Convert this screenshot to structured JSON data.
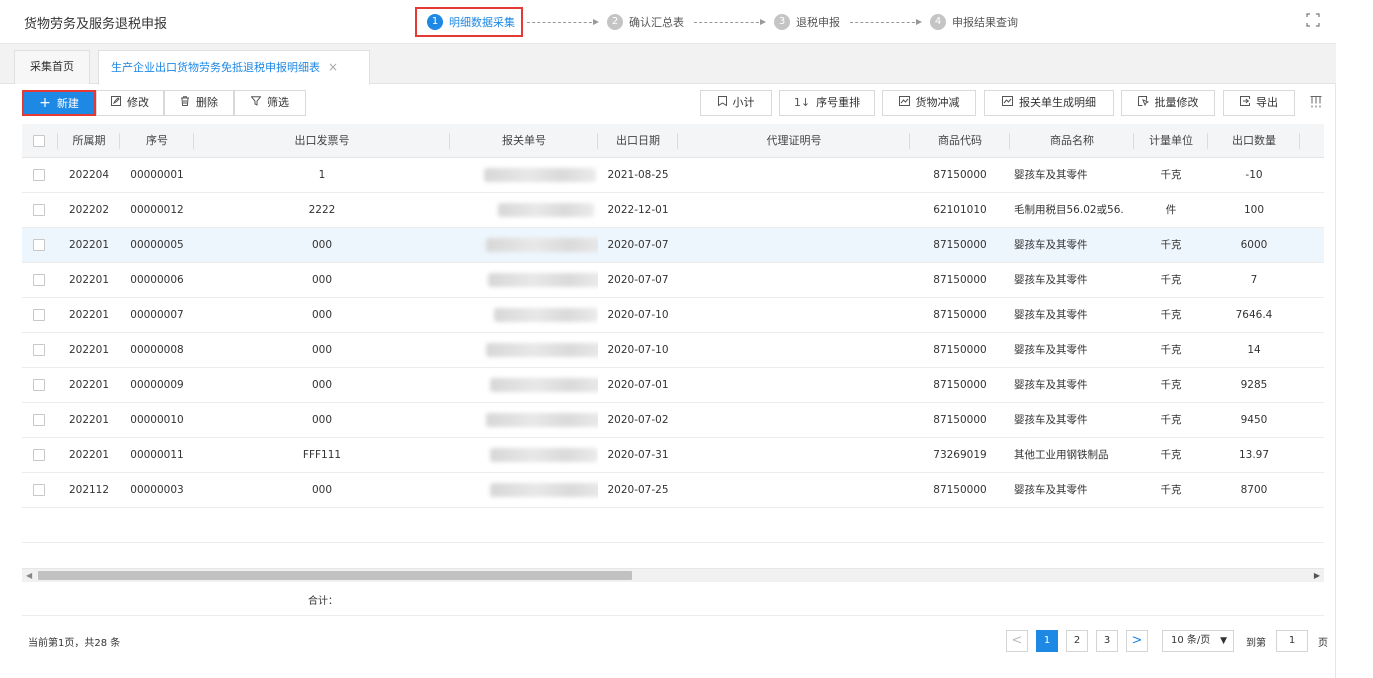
{
  "header": {
    "title": "货物劳务及服务退税申报",
    "steps": [
      {
        "num": "1",
        "label": "明细数据采集"
      },
      {
        "num": "2",
        "label": "确认汇总表"
      },
      {
        "num": "3",
        "label": "退税申报"
      },
      {
        "num": "4",
        "label": "申报结果查询"
      }
    ]
  },
  "tabs": {
    "home": "采集首页",
    "active": "生产企业出口货物劳务免抵退税申报明细表",
    "close": "×"
  },
  "toolbar": {
    "new": "新建",
    "edit": "修改",
    "delete": "删除",
    "filter": "筛选",
    "subtotal": "小计",
    "reorder": "序号重排",
    "offset": "货物冲减",
    "gen_detail": "报关单生成明细",
    "batch_edit": "批量修改",
    "export": "导出"
  },
  "table": {
    "columns": {
      "period": "所属期",
      "seq": "序号",
      "invoice": "出口发票号",
      "customs": "报关单号",
      "date": "出口日期",
      "agent": "代理证明号",
      "code": "商品代码",
      "name": "商品名称",
      "unit": "计量单位",
      "qty": "出口数量"
    },
    "rows": [
      {
        "period": "202204",
        "seq": "00000001",
        "invoice": "1",
        "date": "2021-08-25",
        "agent": "",
        "code": "87150000",
        "name": "婴孩车及其零件",
        "unit": "千克",
        "qty": "-10"
      },
      {
        "period": "202202",
        "seq": "00000012",
        "invoice": "2222",
        "date": "2022-12-01",
        "agent": "",
        "code": "62101010",
        "name": "毛制用税目56.02或56.",
        "unit": "件",
        "qty": "100"
      },
      {
        "period": "202201",
        "seq": "00000005",
        "invoice": "000",
        "date": "2020-07-07",
        "agent": "",
        "code": "87150000",
        "name": "婴孩车及其零件",
        "unit": "千克",
        "qty": "6000"
      },
      {
        "period": "202201",
        "seq": "00000006",
        "invoice": "000",
        "date": "2020-07-07",
        "agent": "",
        "code": "87150000",
        "name": "婴孩车及其零件",
        "unit": "千克",
        "qty": "7"
      },
      {
        "period": "202201",
        "seq": "00000007",
        "invoice": "000",
        "date": "2020-07-10",
        "agent": "",
        "code": "87150000",
        "name": "婴孩车及其零件",
        "unit": "千克",
        "qty": "7646.4"
      },
      {
        "period": "202201",
        "seq": "00000008",
        "invoice": "000",
        "date": "2020-07-10",
        "agent": "",
        "code": "87150000",
        "name": "婴孩车及其零件",
        "unit": "千克",
        "qty": "14"
      },
      {
        "period": "202201",
        "seq": "00000009",
        "invoice": "000",
        "date": "2020-07-01",
        "agent": "",
        "code": "87150000",
        "name": "婴孩车及其零件",
        "unit": "千克",
        "qty": "9285"
      },
      {
        "period": "202201",
        "seq": "00000010",
        "invoice": "000",
        "date": "2020-07-02",
        "agent": "",
        "code": "87150000",
        "name": "婴孩车及其零件",
        "unit": "千克",
        "qty": "9450"
      },
      {
        "period": "202201",
        "seq": "00000011",
        "invoice": "FFF111",
        "date": "2020-07-31",
        "agent": "",
        "code": "73269019",
        "name": "其他工业用钢铁制品",
        "unit": "千克",
        "qty": "13.97"
      },
      {
        "period": "202112",
        "seq": "00000003",
        "invoice": "000",
        "date": "2020-07-25",
        "agent": "",
        "code": "87150000",
        "name": "婴孩车及其零件",
        "unit": "千克",
        "qty": "8700"
      }
    ],
    "summary_label": "合计："
  },
  "pagination": {
    "info": "当前第1页，共28 条",
    "prev": "<",
    "next": ">",
    "pages": [
      "1",
      "2",
      "3"
    ],
    "page_size": "10 条/页",
    "goto_label": "到第",
    "goto_value": "1",
    "goto_suffix": "页"
  },
  "colors": {
    "accent": "#1e88e5",
    "highlight_border": "#e53935",
    "row_highlight": "#eef6fd"
  }
}
